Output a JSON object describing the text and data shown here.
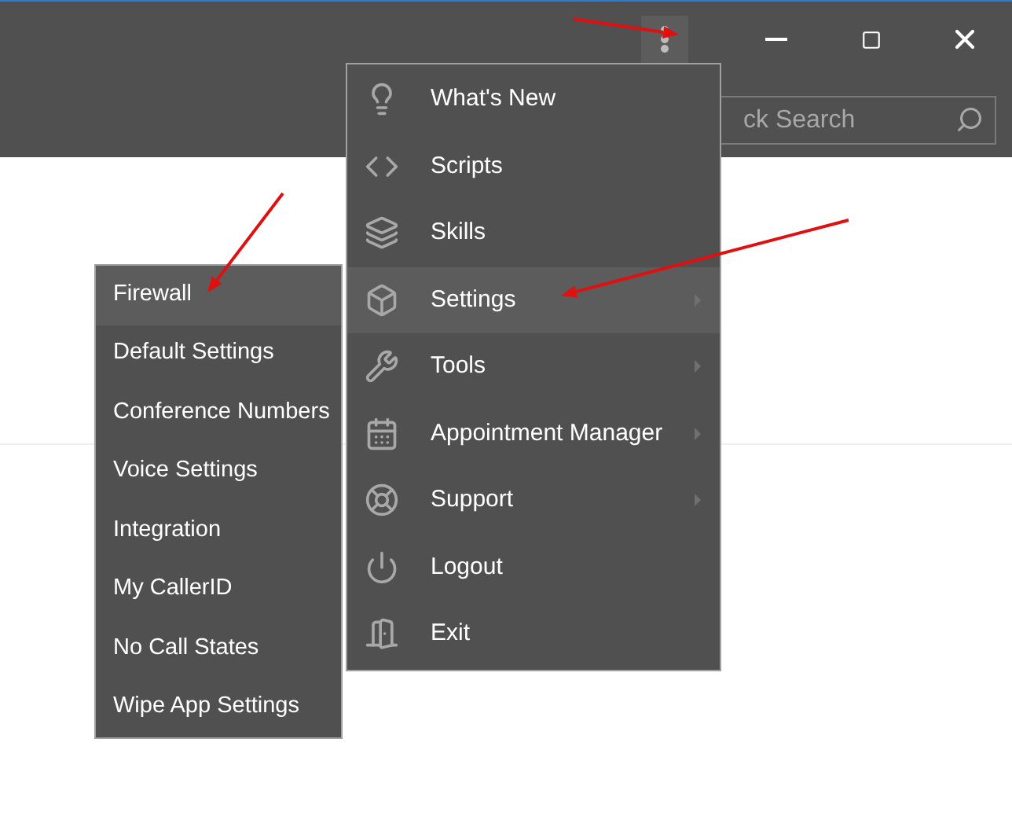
{
  "search": {
    "placeholder": "ck Search"
  },
  "menu": [
    {
      "label": "What's New",
      "has_submenu": false,
      "selected": false
    },
    {
      "label": "Scripts",
      "has_submenu": false,
      "selected": false
    },
    {
      "label": "Skills",
      "has_submenu": false,
      "selected": false
    },
    {
      "label": "Settings",
      "has_submenu": true,
      "selected": true
    },
    {
      "label": "Tools",
      "has_submenu": true,
      "selected": false
    },
    {
      "label": "Appointment Manager",
      "has_submenu": true,
      "selected": false
    },
    {
      "label": "Support",
      "has_submenu": true,
      "selected": false
    },
    {
      "label": "Logout",
      "has_submenu": false,
      "selected": false
    },
    {
      "label": "Exit",
      "has_submenu": false,
      "selected": false
    }
  ],
  "submenu": [
    {
      "label": "Firewall",
      "selected": true
    },
    {
      "label": "Default Settings",
      "selected": false
    },
    {
      "label": "Conference Numbers",
      "selected": false
    },
    {
      "label": "Voice Settings",
      "selected": false
    },
    {
      "label": "Integration",
      "selected": false
    },
    {
      "label": "My CallerID",
      "selected": false
    },
    {
      "label": "No Call States",
      "selected": false
    },
    {
      "label": "Wipe App Settings",
      "selected": false
    }
  ]
}
